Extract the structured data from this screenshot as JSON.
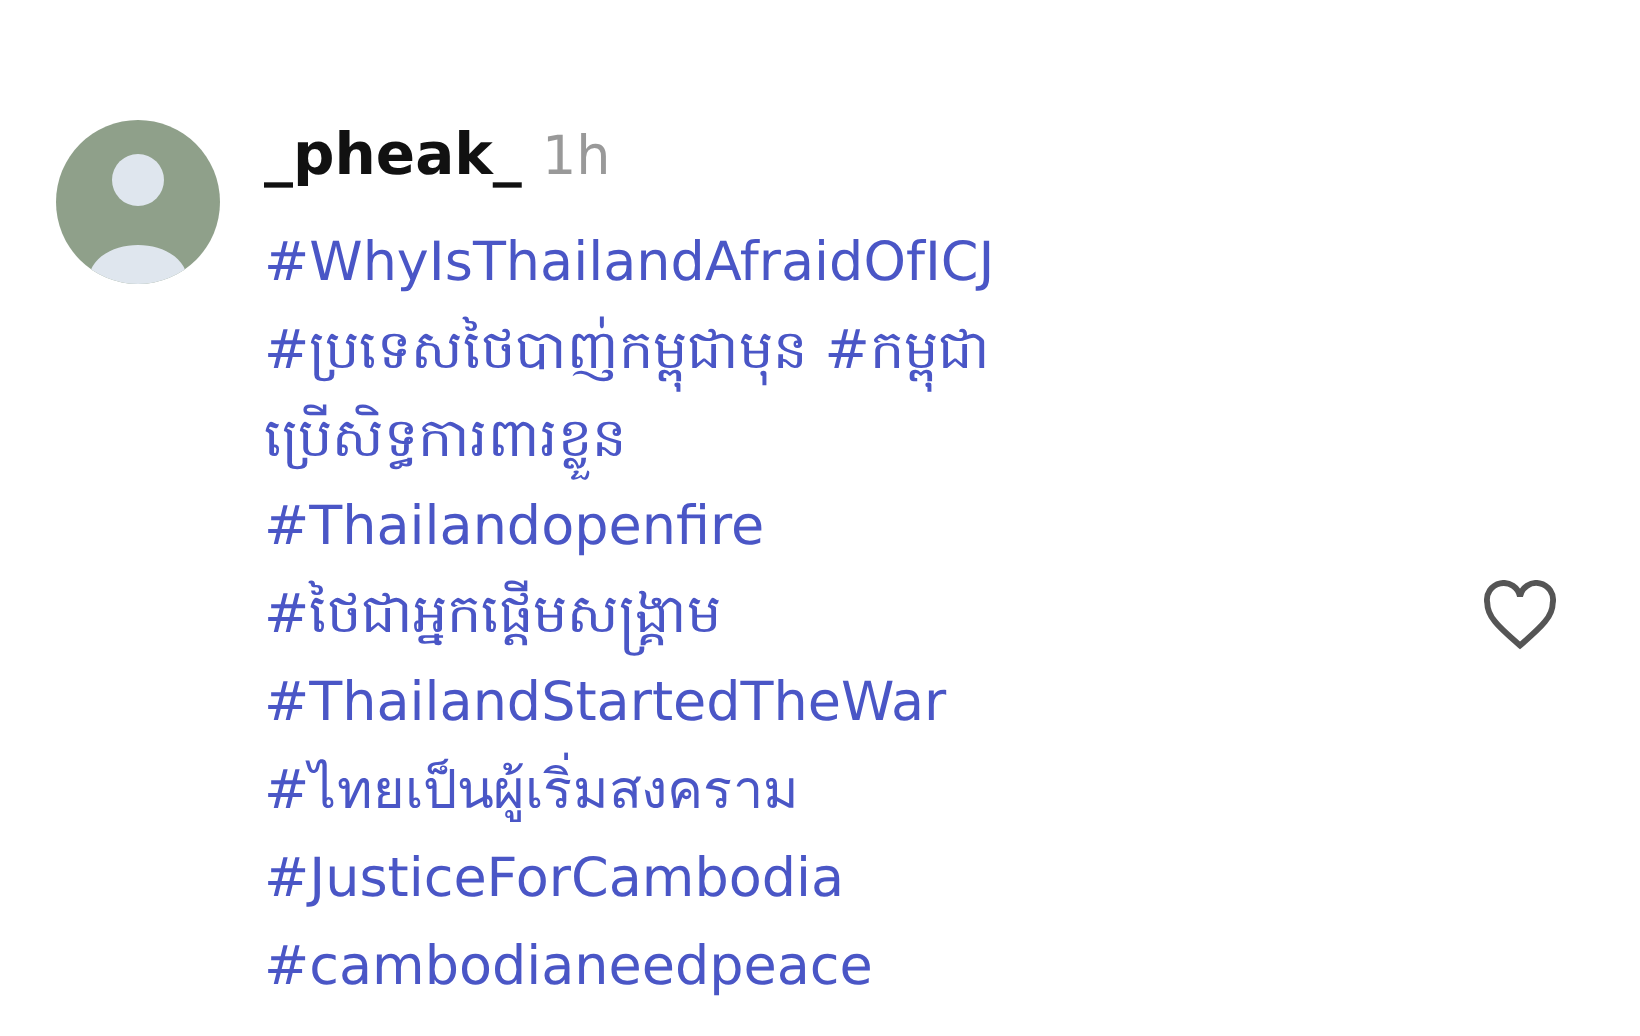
{
  "comment": {
    "username": "_pheak_",
    "time": "1h",
    "liked": false,
    "lines": [
      "#WhyIsThailandAfraidOfICJ",
      "#ប្រទេសថៃបាញ់កម្ពុជាមុន #កម្ពុជា",
      "ប្រើសិទ្ធការពារខ្លួន",
      "#Thailandopenfire",
      "#ថៃជាអ្នកផ្តើមសង្គ្រាម",
      "#ThailandStartedTheWar",
      "#ไทยเป็นผู้เริ่มสงคราม",
      "#JusticeForCambodia",
      "#cambodianeedpeace"
    ]
  }
}
